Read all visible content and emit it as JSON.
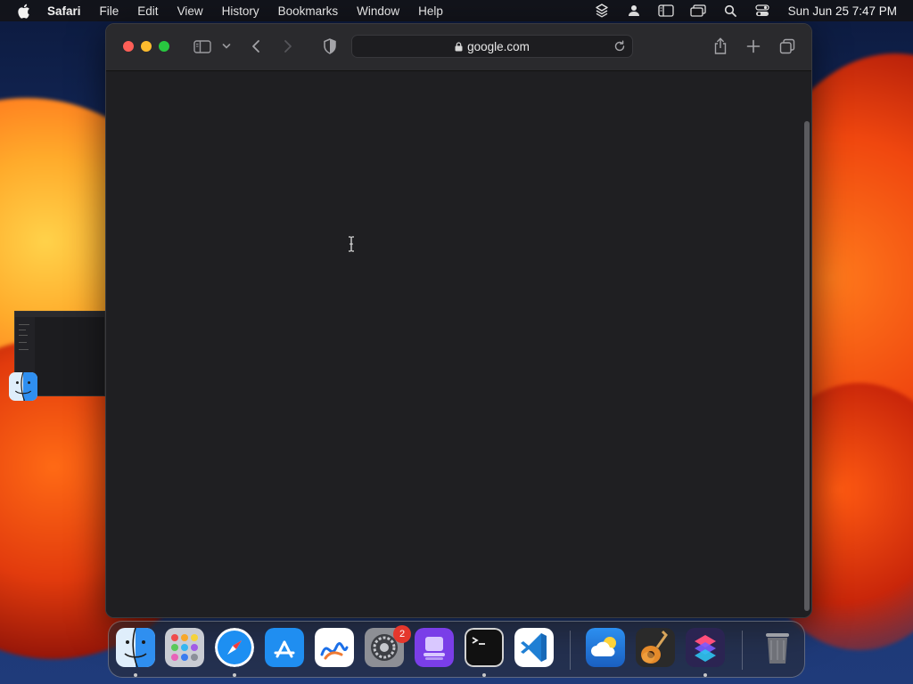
{
  "menubar": {
    "app_name": "Safari",
    "items": [
      "File",
      "Edit",
      "View",
      "History",
      "Bookmarks",
      "Window",
      "Help"
    ],
    "clock": "Sun Jun 25  7:47 PM"
  },
  "safari": {
    "url": "google.com"
  },
  "dock": {
    "apps": [
      "Finder",
      "Launchpad",
      "Safari",
      "App Store",
      "Freeform",
      "System Settings",
      "Apple Configurator",
      "Terminal",
      "Visual Studio Code",
      "Weather",
      "GarageBand",
      "Shortcuts",
      "Trash"
    ],
    "settings_badge": "2"
  }
}
